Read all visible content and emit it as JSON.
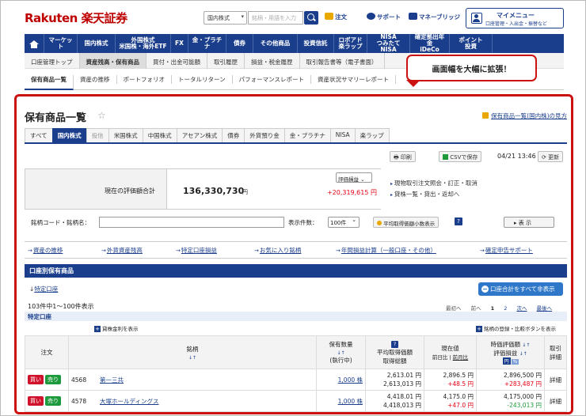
{
  "header": {
    "logo": "Rakuten 楽天証券",
    "market_select": "国内株式",
    "search_placeholder": "銘柄・用語を入力",
    "notice": "注文",
    "support": "サポート",
    "bridge": "マネーブリッジ",
    "mypage_title": "マイメニュー",
    "mypage_sub": "口座管理・入出金・振替など"
  },
  "gnav": [
    {
      "label": "マーケット"
    },
    {
      "label": "国内株式"
    },
    {
      "label": "外国株式\n米国株・海外ETF"
    },
    {
      "label": "FX"
    },
    {
      "label": "金・プラチナ"
    },
    {
      "label": "債券"
    },
    {
      "label": "その他商品"
    },
    {
      "label": "投資信託"
    },
    {
      "label": "ロボアド\n楽ラップ"
    },
    {
      "label": "NISA\nつみたてNISA"
    },
    {
      "label": "確定拠出年金\niDeCo"
    },
    {
      "label": "ポイント\n投資"
    }
  ],
  "subnav": [
    {
      "label": "口座管理トップ",
      "active": false
    },
    {
      "label": "資産残高・保有商品",
      "active": true
    },
    {
      "label": "買付・出金可能額",
      "active": false
    },
    {
      "label": "取引履歴",
      "active": false
    },
    {
      "label": "損益・税金履歴",
      "active": false
    },
    {
      "label": "取引報告書等（電子書面）",
      "active": false
    }
  ],
  "subnav2": [
    {
      "label": "保有商品一覧",
      "active": true
    },
    {
      "label": "資産の推移",
      "active": false
    },
    {
      "label": "ポートフォリオ",
      "active": false
    },
    {
      "label": "トータルリターン",
      "active": false
    },
    {
      "label": "パフォーマンスレポート",
      "active": false
    },
    {
      "label": "資産状況サマリーレポート",
      "active": false
    }
  ],
  "callout": "画面幅を大幅に拡張！",
  "page": {
    "title": "保有商品一覧",
    "help_link": "保有商品一覧(国内株)の見方",
    "tabs": [
      "すべて",
      "国内株式",
      "投信",
      "米国株式",
      "中国株式",
      "アセアン株式",
      "債券",
      "外貨預り金",
      "金・プラチナ",
      "NISA",
      "楽ラップ"
    ],
    "print_btn": "印刷",
    "csv_btn": "CSVで保存",
    "datetime": "04/21 13:46",
    "refresh_btn": "更新"
  },
  "summary": {
    "label": "現在の評価額合計",
    "value": "136,330,730",
    "unit": "円",
    "select": "評価損益",
    "change": "+20,319,615 円",
    "right_links": [
      "現物取引注文照会・訂正・取消",
      "貸株一覧・貸出・返却へ"
    ]
  },
  "filter": {
    "code_label": "銘柄コード・銘柄名：",
    "count_label": "表示件数：",
    "count_value": "100件",
    "avg_btn": "平均取得価額小数表示",
    "show_btn": "表 示"
  },
  "links": [
    "資産の推移",
    "外貨資産残高",
    "特定口座損益",
    "お気に入り銘柄",
    "年間損益計算（一般口座・その他）",
    "確定申告サポート"
  ],
  "section": {
    "title": "口座別保有商品",
    "tree_label": "特定口座",
    "hide_btn": "口座合計をすべて非表示",
    "count_text": "103件中1～100件表示",
    "pager": [
      "最初へ",
      "前へ",
      "1",
      "2",
      "次へ",
      "最後へ"
    ],
    "account": "特定口座",
    "lend_link": "貸株金利を表示",
    "reg_link": "銘柄の登録・比較ボタンを表示"
  },
  "table": {
    "headers": {
      "order": "注文",
      "name": "銘柄",
      "qty": "保有数量",
      "qty_sub": "(執行中)",
      "avg": "平均取得価額",
      "avg_sub": "取得総額",
      "price": "現在値",
      "price_sub1": "前日比",
      "price_sub2": "前月比",
      "val": "時価評価額",
      "val_sub": "評価損益",
      "val_yen": "円",
      "val_pct": "%",
      "detail": "取引\n詳細"
    },
    "buy": "買い",
    "sell": "売り",
    "rows": [
      {
        "code": "4568",
        "name": "第一三共",
        "qty": "1,000 株",
        "avg": "2,613.01 円",
        "avg_total": "2,613,013 円",
        "price": "2,896.5 円",
        "diff": "+48.5 円",
        "val": "2,896,500 円",
        "pl": "+283,487 円",
        "detail": "詳細"
      },
      {
        "code": "4578",
        "name": "大塚ホールディングス",
        "qty": "1,000 株",
        "avg": "4,418.01 円",
        "avg_total": "4,418,013 円",
        "price": "4,175.0 円",
        "diff": "+47.0 円",
        "val": "4,175,000 円",
        "pl": "-243,013 円",
        "detail": "詳細"
      }
    ]
  }
}
